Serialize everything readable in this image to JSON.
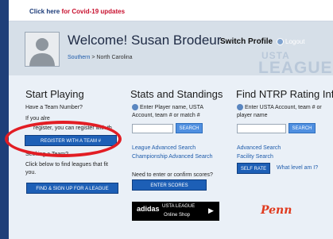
{
  "covid_bar": {
    "click_here": "Click here",
    "covid_text": " for Covid-19 updates"
  },
  "welcome": {
    "title": "Welcome! Susan Brodeur",
    "switch_profile": "Switch Profile",
    "logout": "Logout",
    "breadcrumb_link": "Southern",
    "breadcrumb_rest": " > North Carolina",
    "watermark_usta": "USTA",
    "watermark_league": "LEAGUE"
  },
  "start_playing": {
    "title": "Start Playing",
    "have_team_number": "Have a Team Number?",
    "if_you_already": "If you alre",
    "register_line": "register, you can register with th",
    "register_button": "REGISTER WITH A TEAM #",
    "seeking_team": "Seeking a Team?",
    "find_leagues_1": "Click below to find leagues that fit",
    "find_leagues_2": "you.",
    "find_button": "FIND & SIGN UP FOR A LEAGUE"
  },
  "stats": {
    "title": "Stats and Standings",
    "prompt_1": "Enter Player name, USTA",
    "prompt_2": "Account, team # or match #",
    "search_button": "SEARCH",
    "league_search": "League Advanced Search",
    "championship_search": "Championship Advanced Search",
    "enter_scores_prompt": "Need to enter or confirm scores?",
    "enter_scores_button": "ENTER SCORES",
    "ad_brand": "adidas",
    "ad_usta": "USTA LEAGUE",
    "ad_sub": "Online Shop"
  },
  "ntrp": {
    "title": "Find NTRP Rating Info",
    "prompt_1": "Enter USTA Account, team # or",
    "prompt_2": "player name",
    "search_button": "SEARCH",
    "advanced_search": "Advanced Search",
    "facility_search": "Facility Search",
    "self_rate_button": "SELF RATE",
    "what_level": "What level am I?",
    "sponsor": "Penn"
  }
}
